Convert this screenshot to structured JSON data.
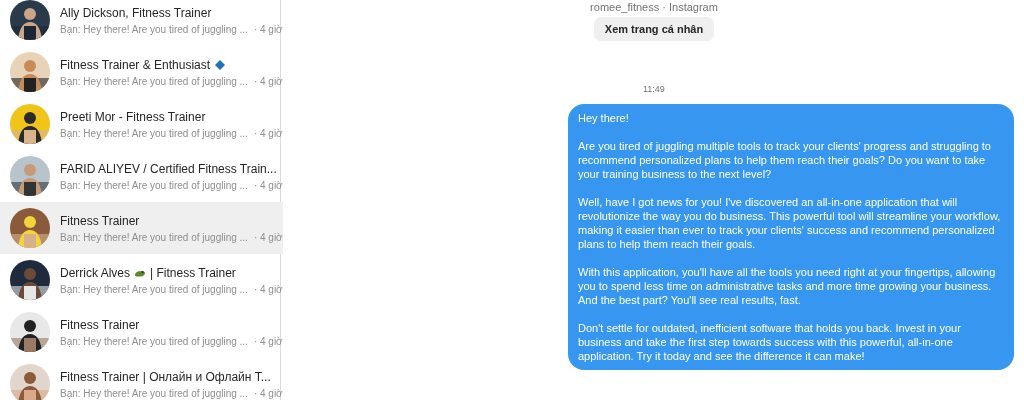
{
  "conversations": [
    {
      "kind": "plain",
      "name": "Ally Dickson, Fitness Trainer",
      "preview": "Bạn: Hey there! Are you tired of juggling ...",
      "time": "· 4 giờ",
      "selected": false
    },
    {
      "kind": "diamond",
      "name": "Fitness Trainer & Enthusiast",
      "preview": "Bạn: Hey there! Are you tired of juggling ...",
      "time": "· 4 giờ",
      "selected": false
    },
    {
      "kind": "plain",
      "name": "Preeti Mor - Fitness Trainer",
      "preview": "Bạn: Hey there! Are you tired of juggling ...",
      "time": "· 4 giờ",
      "selected": false
    },
    {
      "kind": "plain",
      "name": "FARID ALIYEV / Certified Fitness Train...",
      "preview": "Bạn: Hey there! Are you tired of juggling ...",
      "time": "· 4 giờ",
      "selected": false
    },
    {
      "kind": "plain",
      "name": "Fitness Trainer",
      "preview": "Bạn: Hey there! Are you tired of juggling ...",
      "time": "· 4 giờ",
      "selected": true
    },
    {
      "kind": "creature",
      "name": "Derrick Alves",
      "name_suffix": "| Fitness Trainer",
      "preview": "Bạn: Hey there! Are you tired of juggling ...",
      "time": "· 4 giờ",
      "selected": false
    },
    {
      "kind": "plain",
      "name": "Fitness Trainer",
      "preview": "Bạn: Hey there! Are you tired of juggling ...",
      "time": "· 4 giờ",
      "selected": false
    },
    {
      "kind": "plain",
      "name": "Fitness Trainer | Онлайн и Офлайн Т...",
      "preview": "Bạn: Hey there! Are you tired of juggling ...",
      "time": "· 4 giờ",
      "selected": false
    }
  ],
  "profile": {
    "subtitle": "romee_fitness · Instagram",
    "button": "Xem trang cá nhân"
  },
  "timestamp": "11:49",
  "message": {
    "paragraphs": [
      "Hey there!",
      "Are you tired of juggling multiple tools to track your clients' progress and struggling to recommend personalized plans to help them reach their goals? Do you want to take your training business to the next level?",
      "Well, have I got news for you! I've discovered an all-in-one application that will revolutionize the way you do business. This powerful tool will streamline your workflow, making it easier than ever to track your clients' success and recommend personalized plans to help them reach their goals.",
      "With this application, you'll have all the tools you need right at your fingertips, allowing you to spend less time on administrative tasks and more time growing your business. And the best part? You'll see real results, fast.",
      "Don't settle for outdated, inefficient software that holds you back. Invest in your business and take the first step towards success with this powerful, all-in-one application. Try it today and see the difference it can make!"
    ]
  }
}
